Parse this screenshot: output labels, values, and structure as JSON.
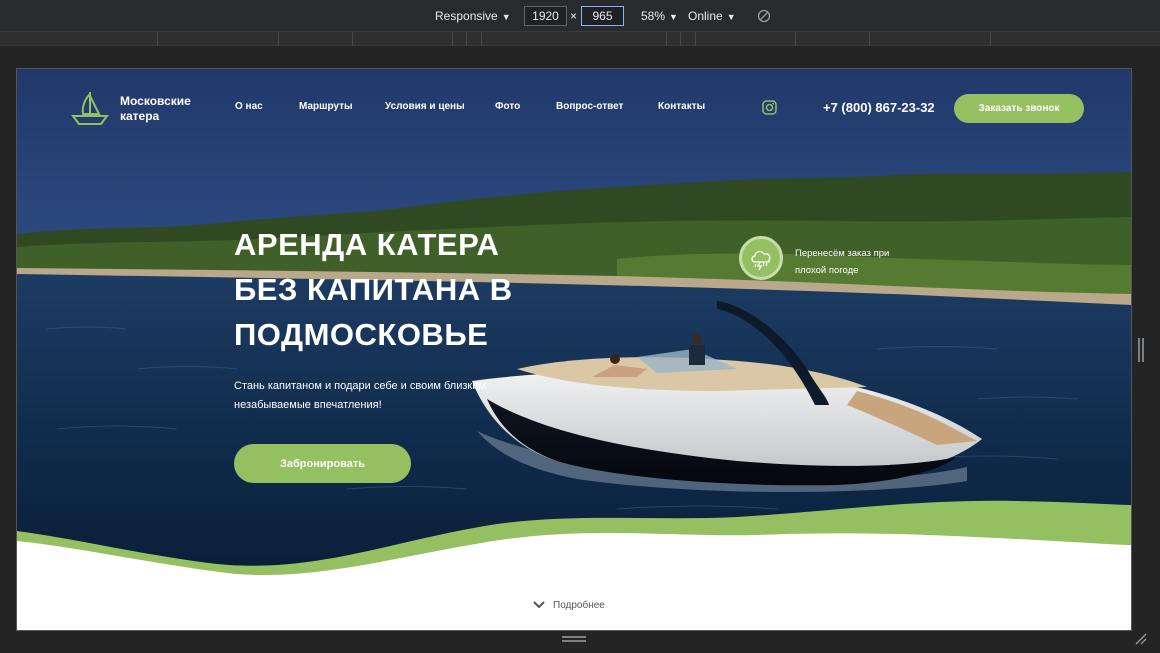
{
  "devtools": {
    "device": "Responsive",
    "width": "1920",
    "height": "965",
    "times": "×",
    "zoom": "58%",
    "network": "Online"
  },
  "site": {
    "logo_text": "Московские катера",
    "nav": [
      "О нас",
      "Маршруты",
      "Условия и цены",
      "Фото",
      "Вопрос-ответ",
      "Контакты"
    ],
    "phone": "+7 (800) 867-23-32",
    "call_button": "Заказать звонок",
    "hero_title": [
      "АРЕНДА КАТЕРА",
      "БЕЗ КАПИТАНА В",
      "ПОДМОСКОВЬЕ"
    ],
    "hero_subtitle": "Стань капитаном и подари себе и своим близким незабываемые впечатления!",
    "book_button": "Забронировать",
    "weather_note": "Перенесём заказ при плохой погоде",
    "more_link": "Подробнее"
  },
  "colors": {
    "accent": "#95c062",
    "devtools_bg": "#292a2d"
  }
}
